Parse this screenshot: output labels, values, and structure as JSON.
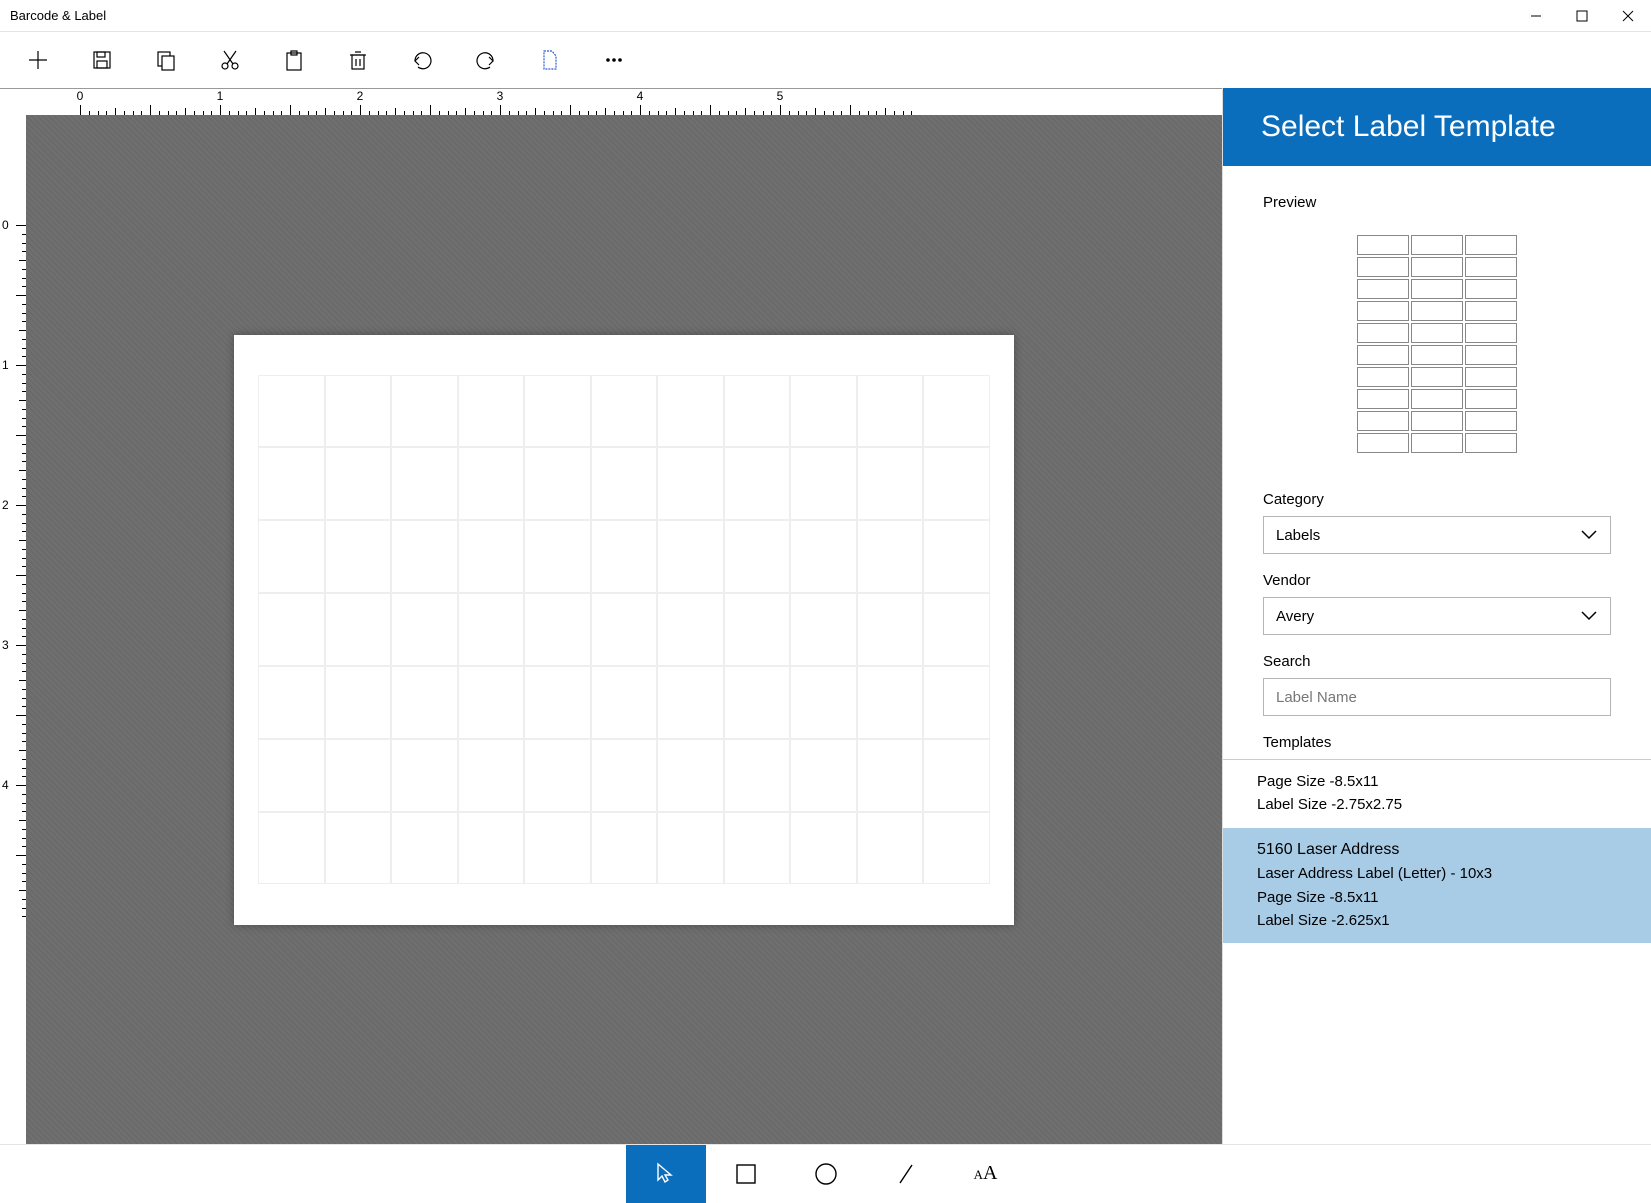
{
  "app_title": "Barcode & Label",
  "ruler_h_labels": [
    "0",
    "1",
    "2",
    "3",
    "4",
    "5"
  ],
  "ruler_v_labels": [
    "0",
    "1",
    "2",
    "3",
    "4"
  ],
  "panel": {
    "title": "Select Label Template",
    "preview_label": "Preview",
    "category_label": "Category",
    "category_value": "Labels",
    "vendor_label": "Vendor",
    "vendor_value": "Avery",
    "search_label": "Search",
    "search_placeholder": "Label Name",
    "templates_label": "Templates"
  },
  "templates": {
    "item0": {
      "page_size": "Page Size -8.5x11",
      "label_size": "Label Size -2.75x2.75"
    },
    "item1": {
      "title": "5160 Laser Address",
      "desc": "Laser Address Label (Letter) - 10x3",
      "page_size": "Page Size -8.5x11",
      "label_size": "Label Size -2.625x1"
    }
  }
}
